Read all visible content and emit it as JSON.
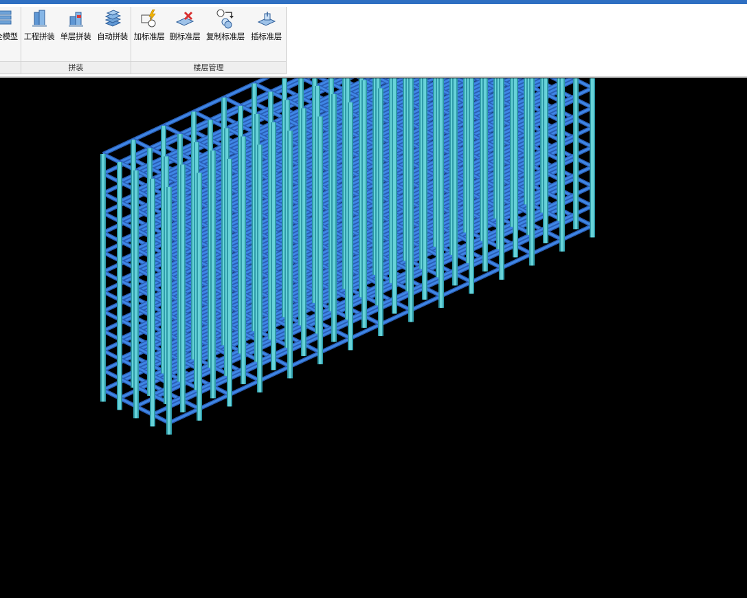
{
  "ribbon": {
    "groups": [
      {
        "label": "",
        "buttons": [
          {
            "label": "全模型",
            "icon": "full-model-icon"
          }
        ]
      },
      {
        "label": "拼装",
        "buttons": [
          {
            "label": "工程拼装",
            "icon": "project-assembly-icon"
          },
          {
            "label": "单层拼装",
            "icon": "single-floor-assembly-icon"
          },
          {
            "label": "自动拼装",
            "icon": "auto-assembly-icon"
          }
        ]
      },
      {
        "label": "楼层管理",
        "buttons": [
          {
            "label": "加标准层",
            "icon": "add-standard-floor-icon"
          },
          {
            "label": "删标准层",
            "icon": "delete-standard-floor-icon"
          },
          {
            "label": "复制标准层",
            "icon": "copy-standard-floor-icon"
          },
          {
            "label": "插标准层",
            "icon": "insert-standard-floor-icon"
          }
        ]
      }
    ]
  },
  "model": {
    "floors": 12,
    "bays_long": 14,
    "bays_short": 4,
    "colors": {
      "beam": "#3f86e6",
      "beam_edge": "#2a5fb5",
      "column": "#67d2d8",
      "column_edge": "#2f9aa8",
      "background": "#000000"
    }
  }
}
